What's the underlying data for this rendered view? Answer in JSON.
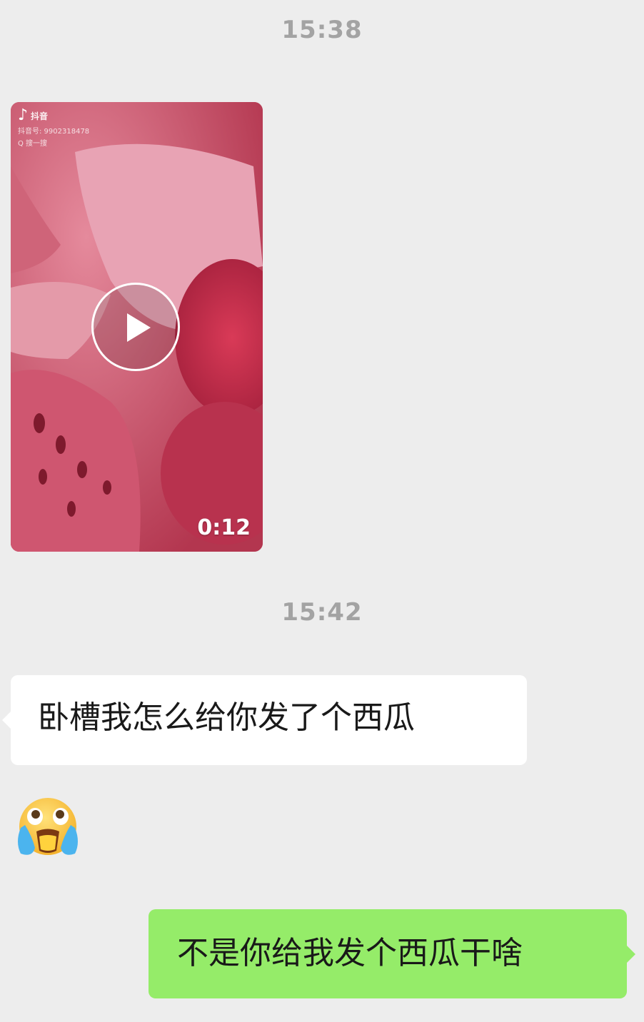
{
  "messages": {
    "timestamp_1": "15:38",
    "video": {
      "duration": "0:12",
      "play_icon": "play-icon",
      "watermark": {
        "app_name": "抖音",
        "account_id": "抖音号: 9902318478",
        "search_hint": "Q 搜一搜"
      }
    },
    "timestamp_2": "15:42",
    "incoming_text": "卧槽我怎么给你发了个西瓜",
    "incoming_emoji": "crying-face-emoji",
    "outgoing_text": "不是你给我发个西瓜干啥"
  },
  "colors": {
    "background": "#ededed",
    "incoming_bubble": "#ffffff",
    "outgoing_bubble": "#95ec69",
    "timestamp": "#a3a3a3"
  }
}
